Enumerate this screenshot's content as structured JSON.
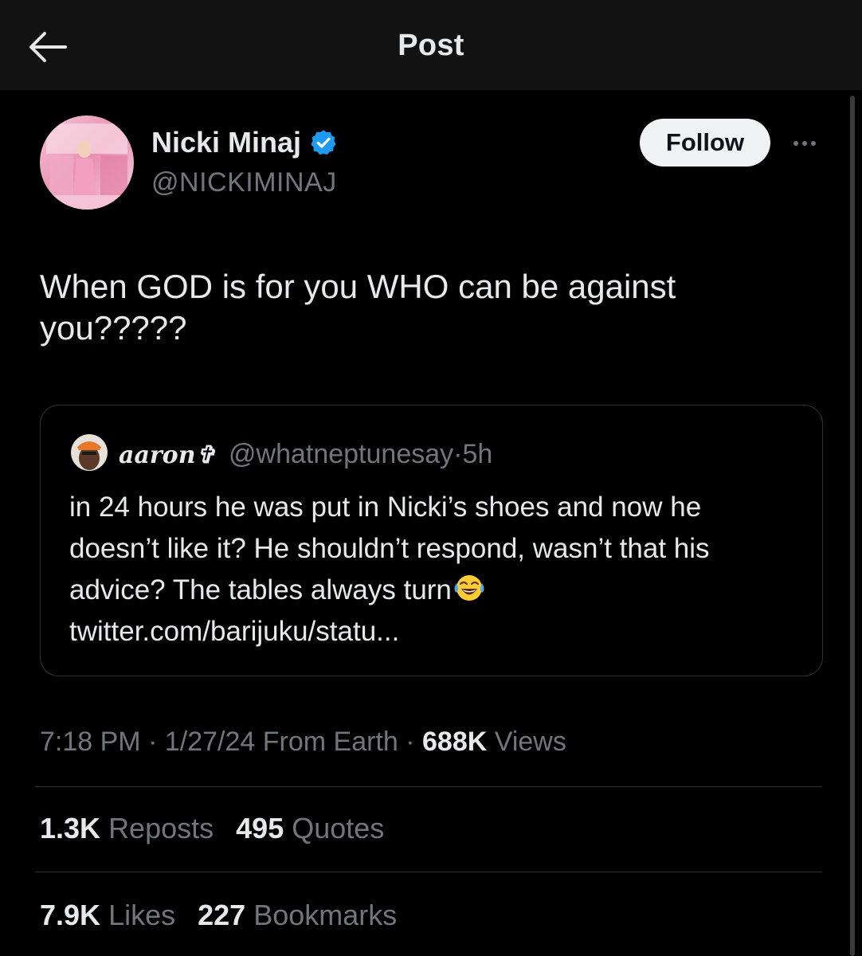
{
  "header": {
    "title": "Post",
    "back_icon": "arrow-left-icon"
  },
  "post": {
    "author": {
      "name": "Nicki Minaj",
      "handle": "@NICKIMINAJ",
      "verified_color": "#1d9bf0"
    },
    "follow_label": "Follow",
    "text": "When GOD is for you WHO can be against you?????",
    "quoted": {
      "name": "aaron✞",
      "handle": "@whatneptunesay",
      "separator": "·",
      "time": "5h",
      "text": "in 24 hours he was put in Nicki’s shoes and now he doesn’t like it? He shouldn’t respond, wasn’t that his advice? The tables always turn",
      "link": "twitter.com/barijuku/statu..."
    },
    "meta": {
      "time": "7:18 PM",
      "date": "1/27/24",
      "location": "From Earth",
      "views_count": "688K",
      "views_label": "Views"
    },
    "stats": {
      "reposts_count": "1.3K",
      "reposts_label": "Reposts",
      "quotes_count": "495",
      "quotes_label": "Quotes",
      "likes_count": "7.9K",
      "likes_label": "Likes",
      "bookmarks_count": "227",
      "bookmarks_label": "Bookmarks"
    }
  },
  "colors": {
    "background": "#000000",
    "header_bg": "#121212",
    "primary_text": "#e7e9ea",
    "secondary_text": "#71767b",
    "border": "#2f3336"
  }
}
